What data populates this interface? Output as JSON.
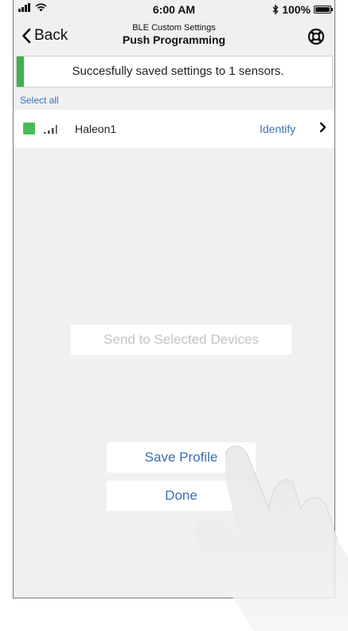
{
  "status_bar": {
    "time": "6:00 AM",
    "battery_text": "100%",
    "bluetooth_icon": "bluetooth-icon",
    "signal_icon": "cellular-signal-icon",
    "wifi_icon": "wifi-icon"
  },
  "nav": {
    "back_label": "Back",
    "subtitle": "BLE Custom Settings",
    "title": "Push Programming",
    "help_icon": "lifebuoy-icon"
  },
  "banner": {
    "message": "Succesfully saved settings to 1 sensors.",
    "accent_color": "#3fb14a"
  },
  "select_all_label": "Select all",
  "devices": [
    {
      "name": "Haleon1",
      "selected": true,
      "action_label": "Identify",
      "signal_icon": "signal-strength-icon",
      "chevron": "›"
    }
  ],
  "buttons": {
    "send": "Send to Selected Devices",
    "save_profile": "Save Profile",
    "done": "Done"
  },
  "colors": {
    "link": "#3a74b8",
    "selected": "#4cbb57",
    "disabled_text": "#c4c4c8"
  }
}
